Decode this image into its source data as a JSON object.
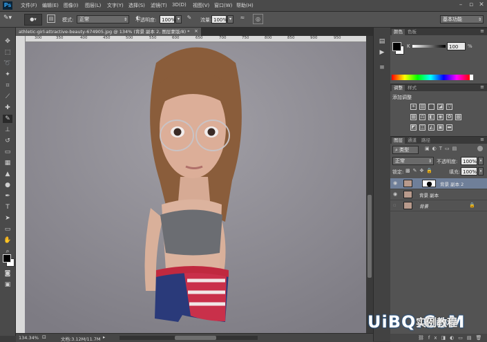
{
  "app": {
    "logo": "Ps"
  },
  "menu": [
    "文件(F)",
    "编辑(E)",
    "图像(I)",
    "图层(L)",
    "文字(Y)",
    "选择(S)",
    "滤镜(T)",
    "3D(D)",
    "视图(V)",
    "窗口(W)",
    "帮助(H)"
  ],
  "options": {
    "mode_label": "模式:",
    "mode_value": "正常",
    "opacity_label": "不透明度:",
    "opacity_value": "100%",
    "flow_label": "流量:",
    "flow_value": "100%",
    "workspace": "基本功能"
  },
  "document": {
    "tab_title": "athletic-girl-attractive-beauty-674905.jpg @ 134% (背景 副本 2, 图层蒙版/8) *",
    "ruler_ticks": [
      "300",
      "350",
      "400",
      "450",
      "500",
      "550",
      "600",
      "650",
      "700",
      "750",
      "800",
      "850",
      "900",
      "950"
    ],
    "zoom": "134.34%",
    "doc_info": "文档:3.12M/11.7M"
  },
  "color_panel": {
    "tabs": [
      "颜色",
      "色板"
    ],
    "channel": "K",
    "value": "100",
    "unit": "%"
  },
  "adjust_panel": {
    "tabs": [
      "调整",
      "样式"
    ],
    "add_label": "添加调整"
  },
  "layers_panel": {
    "tabs": [
      "图层",
      "通道",
      "路径"
    ],
    "filter_kind": "类型",
    "blend_mode": "正常",
    "opacity_label": "不透明度:",
    "opacity_value": "100%",
    "lock_label": "锁定:",
    "fill_label": "填充:",
    "fill_value": "100%",
    "layers": [
      {
        "name": "背景 副本 2",
        "selected": true
      },
      {
        "name": "背景 副本",
        "selected": false
      },
      {
        "name": "背景",
        "selected": false
      }
    ]
  },
  "watermark": {
    "text": "UiBQ.CoM",
    "cn": "实例教程"
  },
  "colors": {
    "accent": "#2fa3f4",
    "canvas": "#8e8c94",
    "panel": "#535353"
  }
}
